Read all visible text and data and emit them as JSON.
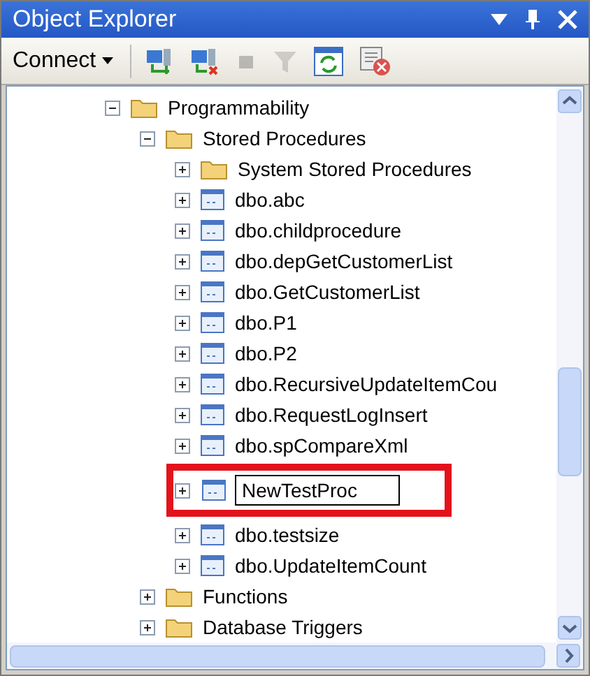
{
  "window": {
    "title": "Object Explorer"
  },
  "toolbar": [
    {
      "kind": "connect-menu",
      "label": "Connect",
      "disabled": false
    },
    {
      "kind": "connect",
      "disabled": false
    },
    {
      "kind": "disconnect",
      "disabled": false
    },
    {
      "kind": "stop",
      "disabled": true
    },
    {
      "kind": "filter",
      "disabled": true
    },
    {
      "kind": "refresh",
      "disabled": false
    },
    {
      "kind": "script",
      "disabled": false
    }
  ],
  "tree": [
    {
      "label": "Programmability",
      "kind": "folder",
      "expanded": true,
      "children": [
        {
          "label": "Stored Procedures",
          "kind": "folder",
          "expanded": true,
          "children": [
            {
              "label": "System Stored Procedures",
              "kind": "folder",
              "expanded": false
            },
            {
              "label": "dbo.abc",
              "kind": "procedure",
              "expanded": false
            },
            {
              "label": "dbo.childprocedure",
              "kind": "procedure",
              "expanded": false
            },
            {
              "label": "dbo.depGetCustomerList",
              "kind": "procedure",
              "expanded": false
            },
            {
              "label": "dbo.GetCustomerList",
              "kind": "procedure",
              "expanded": false
            },
            {
              "label": "dbo.P1",
              "kind": "procedure",
              "expanded": false
            },
            {
              "label": "dbo.P2",
              "kind": "procedure",
              "expanded": false
            },
            {
              "label": "dbo.RecursiveUpdateItemCou",
              "kind": "procedure",
              "expanded": false
            },
            {
              "label": "dbo.RequestLogInsert",
              "kind": "procedure",
              "expanded": false
            },
            {
              "label": "dbo.spCompareXml",
              "kind": "procedure",
              "expanded": false
            },
            {
              "value": "NewTestProc",
              "kind": "procedure",
              "expanded": false,
              "editing": true
            },
            {
              "label": "dbo.testsize",
              "kind": "procedure",
              "expanded": false
            },
            {
              "label": "dbo.UpdateItemCount",
              "kind": "procedure",
              "expanded": false
            }
          ]
        },
        {
          "label": "Functions",
          "kind": "folder",
          "expanded": false
        },
        {
          "label": "Database Triggers",
          "kind": "folder",
          "expanded": false
        }
      ]
    }
  ]
}
